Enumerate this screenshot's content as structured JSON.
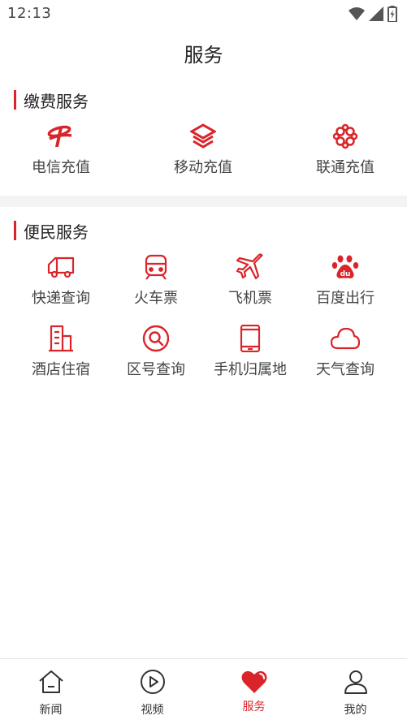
{
  "status_bar": {
    "time": "12:13",
    "icons": [
      "wifi-icon",
      "cell-signal-icon",
      "battery-charging-icon"
    ]
  },
  "page": {
    "title": "服务"
  },
  "sections": {
    "payment": {
      "title": "缴费服务",
      "items": [
        {
          "label": "电信充值",
          "icon": "china-telecom-icon"
        },
        {
          "label": "移动充值",
          "icon": "china-mobile-icon"
        },
        {
          "label": "联通充值",
          "icon": "china-unicom-icon"
        }
      ]
    },
    "convenience": {
      "title": "便民服务",
      "items": [
        {
          "label": "快递查询",
          "icon": "delivery-truck-icon"
        },
        {
          "label": "火车票",
          "icon": "train-icon"
        },
        {
          "label": "飞机票",
          "icon": "airplane-icon"
        },
        {
          "label": "百度出行",
          "icon": "baidu-paw-icon"
        },
        {
          "label": "酒店住宿",
          "icon": "hotel-building-icon"
        },
        {
          "label": "区号查询",
          "icon": "search-magnifier-icon"
        },
        {
          "label": "手机归属地",
          "icon": "mobile-phone-icon"
        },
        {
          "label": "天气查询",
          "icon": "cloud-icon"
        }
      ]
    }
  },
  "tab_bar": {
    "tabs": [
      {
        "label": "新闻",
        "icon": "home-icon",
        "active": false
      },
      {
        "label": "视频",
        "icon": "play-circle-icon",
        "active": false
      },
      {
        "label": "服务",
        "icon": "heart-icon",
        "active": true
      },
      {
        "label": "我的",
        "icon": "user-icon",
        "active": false
      }
    ]
  },
  "colors": {
    "accent": "#d9252a",
    "text_primary": "#222222",
    "text_secondary": "#444444",
    "section_divider": "#f3f3f3"
  }
}
